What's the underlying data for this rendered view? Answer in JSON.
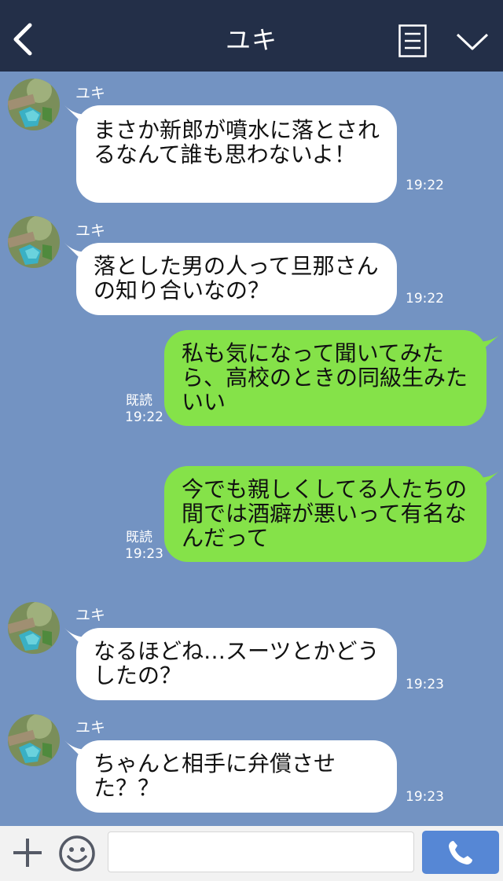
{
  "header": {
    "title": "ユキ",
    "back_icon": "chevron-left-icon",
    "menu_icon": "menu-icon",
    "collapse_icon": "chevron-down-icon"
  },
  "messages": [
    {
      "sender": "ユキ",
      "text": "まさか新郎が噴水に落とされるなんて誰も思わないよ！",
      "time": "19:22"
    },
    {
      "sender": "ユキ",
      "text": "落とした男の人って旦那さんの知り合いなの？",
      "time": "19:22"
    },
    {
      "read": "既読",
      "text": "私も気になって聞いてみたら、高校のときの同級生みたいい",
      "time": "19:22"
    },
    {
      "read": "既読",
      "text": "今でも親しくしてる人たちの間では酒癖が悪いって有名なんだって",
      "time": "19:23"
    },
    {
      "sender": "ユキ",
      "text": "なるほどね…スーツとかどうしたの？",
      "time": "19:23"
    },
    {
      "sender": "ユキ",
      "text": "ちゃんと相手に弁償させた？？",
      "time": "19:23"
    }
  ],
  "footer": {
    "add_icon": "plus-icon",
    "emoji_icon": "smiley-icon",
    "message_placeholder": "",
    "call_icon": "phone-icon"
  },
  "colors": {
    "background": "#7393c2",
    "header": "#232f48",
    "incoming_bubble": "#ffffff",
    "outgoing_bubble": "#85e249",
    "call_button": "#5687d5"
  }
}
